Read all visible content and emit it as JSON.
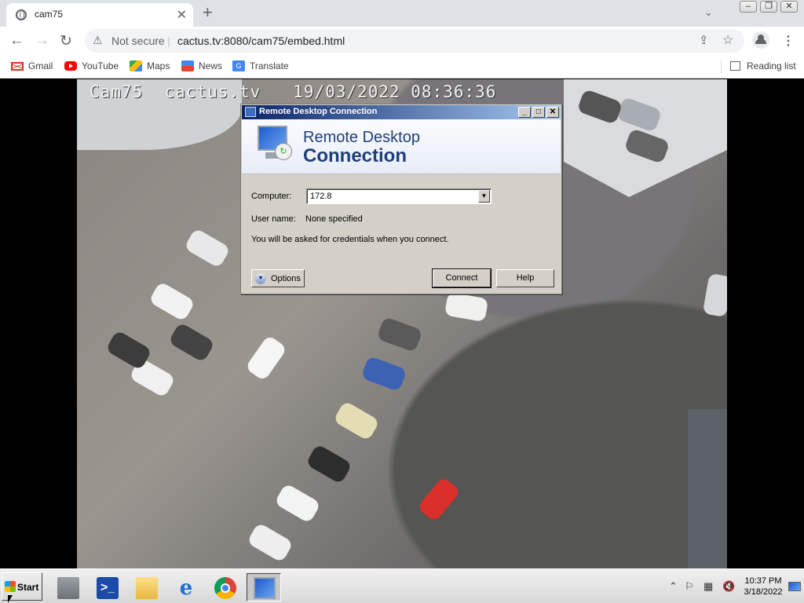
{
  "browser": {
    "tab_title": "cam75",
    "new_tab_symbol": "+",
    "tab_search_symbol": "⌄",
    "omnibox": {
      "security_label": "Not secure",
      "url": "cactus.tv:8080/cam75/embed.html"
    },
    "bookmarks": [
      {
        "label": "Gmail",
        "icon": "gmail-icon",
        "color": "#d93025"
      },
      {
        "label": "YouTube",
        "icon": "youtube-icon",
        "color": "#ff0000"
      },
      {
        "label": "Maps",
        "icon": "maps-icon",
        "color": "#34a853"
      },
      {
        "label": "News",
        "icon": "news-icon",
        "color": "#4285f4"
      },
      {
        "label": "Translate",
        "icon": "translate-icon",
        "color": "#4285f4"
      }
    ],
    "reading_list_label": "Reading list"
  },
  "video": {
    "osd_text": "Cam75  cactus.tv   19/03/2022 08:36:36"
  },
  "rdc_dialog": {
    "title": "Remote Desktop Connection",
    "banner_line1": "Remote Desktop",
    "banner_line2": "Connection",
    "computer_label": "Computer:",
    "computer_value": "172.8",
    "username_label": "User name:",
    "username_value": "None specified",
    "credentials_note": "You will be asked for credentials when you connect.",
    "options_label": "Options",
    "connect_label": "Connect",
    "help_label": "Help"
  },
  "taskbar": {
    "start_label": "Start",
    "apps": [
      {
        "name": "server-manager-icon",
        "active": false
      },
      {
        "name": "powershell-icon",
        "active": false
      },
      {
        "name": "explorer-icon",
        "active": false
      },
      {
        "name": "internet-explorer-icon",
        "active": false
      },
      {
        "name": "chrome-icon",
        "active": false
      },
      {
        "name": "remote-desktop-icon",
        "active": true
      }
    ],
    "clock_time": "10:37 PM",
    "clock_date": "3/18/2022"
  }
}
